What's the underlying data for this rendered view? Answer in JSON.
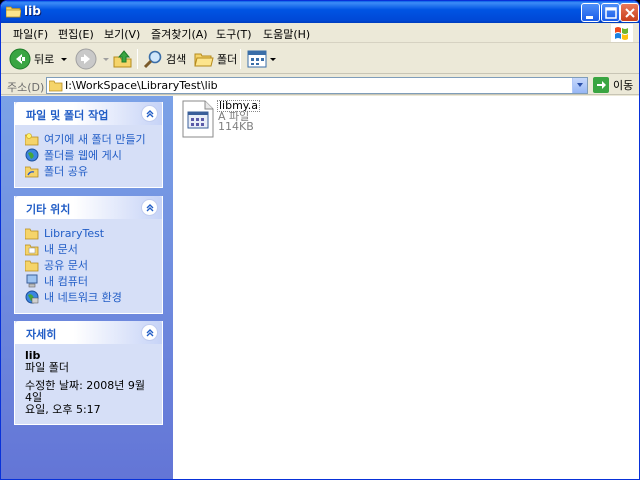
{
  "window": {
    "title": "lib"
  },
  "menu": [
    "파일(F)",
    "편집(E)",
    "보기(V)",
    "즐겨찾기(A)",
    "도구(T)",
    "도움말(H)"
  ],
  "toolbar": {
    "back_label": "뒤로",
    "search_label": "검색",
    "folders_label": "폴더"
  },
  "address": {
    "label": "주소(D)",
    "path": "I:\\WorkSpace\\LibraryTest\\lib",
    "go_label": "이동"
  },
  "tasks_panel": {
    "title": "파일 및 폴더 작업",
    "items": [
      {
        "label": "여기에 새 폴더 만들기",
        "icon": "new-folder-icon"
      },
      {
        "label": "폴더를 웹에 게시",
        "icon": "publish-web-icon"
      },
      {
        "label": "폴더 공유",
        "icon": "share-folder-icon"
      }
    ]
  },
  "places_panel": {
    "title": "기타 위치",
    "items": [
      {
        "label": "LibraryTest",
        "icon": "folder-icon"
      },
      {
        "label": "내 문서",
        "icon": "my-documents-icon"
      },
      {
        "label": "공유 문서",
        "icon": "shared-documents-icon"
      },
      {
        "label": "내 컴퓨터",
        "icon": "my-computer-icon"
      },
      {
        "label": "내 네트워크 환경",
        "icon": "network-places-icon"
      }
    ]
  },
  "details_panel": {
    "title": "자세히",
    "name": "lib",
    "type": "파일 폴더",
    "modified_line1": "수정한 날짜: 2008년 9월 4일",
    "modified_line2": "요일, 오후 5:17"
  },
  "files": [
    {
      "name": "libmy.a",
      "type": "A 파일",
      "size": "114KB"
    }
  ],
  "colors": {
    "titlebar": "#0054e3",
    "task_link": "#215dc6",
    "pane": "#6f8bdc"
  }
}
